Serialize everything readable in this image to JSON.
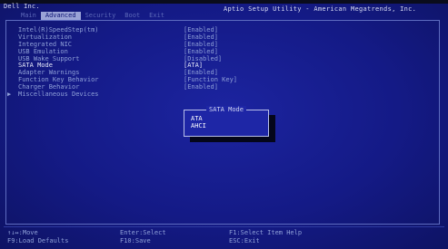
{
  "header": {
    "vendor": "Dell Inc.",
    "utility_title": "Aptio Setup Utility - American Megatrends, Inc."
  },
  "tabs": [
    {
      "label": "Main",
      "active": false
    },
    {
      "label": "Advanced",
      "active": true
    },
    {
      "label": "Security",
      "active": false
    },
    {
      "label": "Boot",
      "active": false
    },
    {
      "label": "Exit",
      "active": false
    }
  ],
  "settings": [
    {
      "label": "Intel(R)SpeedStep(tm)",
      "value": "[Enabled]"
    },
    {
      "label": "Virtualization",
      "value": "[Enabled]"
    },
    {
      "label": "Integrated NIC",
      "value": "[Enabled]"
    },
    {
      "label": "USB Emulation",
      "value": "[Enabled]"
    },
    {
      "label": "USB Wake Support",
      "value": "[Disabled]"
    },
    {
      "label": "SATA Mode",
      "value": "[ATA]"
    },
    {
      "label": "Adapter Warnings",
      "value": "[Enabled]"
    },
    {
      "label": "Function Key Behavior",
      "value": "[Function Key]"
    },
    {
      "label": "Charger Behavior",
      "value": "[Enabled]"
    },
    {
      "label": "Miscellaneous Devices",
      "value": "",
      "submenu_marker": "▶"
    }
  ],
  "popup": {
    "title": "SATA Mode",
    "options": [
      "ATA",
      "AHCI"
    ]
  },
  "keys": {
    "move": "↑↓↔:Move",
    "load_defaults": "F9:Load Defaults",
    "enter_select": "Enter:Select",
    "save": "F10:Save",
    "item_help": "F1:Select Item Help",
    "exit": "ESC:Exit"
  },
  "colors": {
    "background": "#141a86",
    "active_tab": "#9aa3d6",
    "text": "#8fa0d8",
    "highlight_text": "#e6e9fa"
  }
}
